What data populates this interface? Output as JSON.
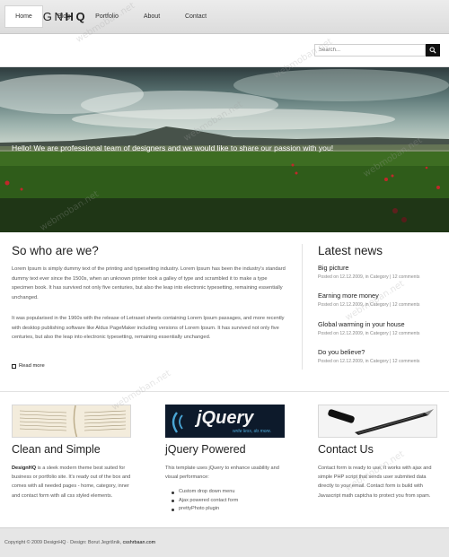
{
  "header": {
    "logo_light": "DESIGN",
    "logo_bold": "HQ"
  },
  "nav": {
    "items": [
      {
        "label": "Home",
        "active": true
      },
      {
        "label": "Blog"
      },
      {
        "label": "Portfolio"
      },
      {
        "label": "About"
      },
      {
        "label": "Contact"
      }
    ]
  },
  "search": {
    "placeholder": "Search...",
    "button_icon": "magnifier-icon"
  },
  "hero": {
    "caption": "Hello! We are professional team of designers and we would like to share our passion with you!"
  },
  "about": {
    "title": "So who are we?",
    "paragraph1": "Lorem Ipsum is simply dummy text of the printing and typesetting industry. Lorem Ipsum has been the industry's standard dummy text ever since the 1500s, when an unknown printer took a galley of type and scrambled it to make a type specimen book. It has survived not only five centuries, but also the leap into electronic typesetting, remaining essentially unchanged.",
    "paragraph2": "It was popularised in the 1960s with the release of Letraset sheets containing Lorem Ipsum passages, and more recently with desktop publishing software like Aldus PageMaker including versions of Lorem Ipsum. It has survived not only five centuries, but also the leap into electronic typesetting, remaining essentially unchanged.",
    "read_more": "Read more"
  },
  "news": {
    "title": "Latest news",
    "items": [
      {
        "title": "Big picture",
        "meta": "Posted on 12.12.2009, in Category | 12 comments"
      },
      {
        "title": "Earning more money",
        "meta": "Posted on 12.12.2009, in Category | 12 comments"
      },
      {
        "title": "Global warming in your house",
        "meta": "Posted on 12.12.2009, in Category | 12 comments"
      },
      {
        "title": "Do you believe?",
        "meta": "Posted on 12.12.2009, in Category | 12 comments"
      }
    ]
  },
  "features": [
    {
      "title": "Clean and Simple",
      "lead": "DesignHQ",
      "text": " is a sleek modern theme best suited for business or portfolio site. It's ready out of the box and comes with all needed pages - home, category, inner and contact form with all css styled elements."
    },
    {
      "title": "jQuery Powered",
      "logo_text": "jQuery",
      "logo_tagline": "write less, do more.",
      "text": "This template uses jQuery to enhance usability and visual performance:",
      "bullets": [
        "Custom drop down menu",
        "Ajax powered contact form",
        "prettyPhoto plugin"
      ]
    },
    {
      "title": "Contact Us",
      "text": "Contact form is ready to use. It works with ajax and simple PHP script that sends user submited data directly to your email. Contact form is build with Javascript math captcha to protect you from spam."
    }
  ],
  "footer": {
    "text": "Copyright © 2009 DesignHQ · Design: Borut Jegrišnik, ",
    "link": "csshrbaan.com"
  },
  "watermark": "webmoban.net",
  "colors": {
    "accent": "#111111",
    "hero_overlay": "#1a241a",
    "footer_bg": "#e6e6e6"
  }
}
